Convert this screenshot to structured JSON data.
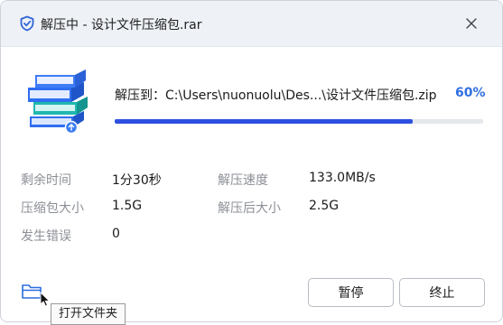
{
  "window": {
    "title": "解压中 - 设计文件压缩包.rar"
  },
  "extract": {
    "path_label": "解压到：C:\\Users\\nuonuolu\\Des...\\设计文件压缩包.zip",
    "percent_text": "60%",
    "progress": 0.81
  },
  "stats": {
    "remaining_time_label": "剩余时间",
    "remaining_time_value": "1分30秒",
    "speed_label": "解压速度",
    "speed_value": "133.0MB/s",
    "archive_size_label": "压缩包大小",
    "archive_size_value": "1.5G",
    "extracted_size_label": "解压后大小",
    "extracted_size_value": "2.5G",
    "errors_label": "发生错误",
    "errors_value": "0"
  },
  "footer": {
    "tooltip": "打开文件夹",
    "pause_label": "暂停",
    "stop_label": "终止"
  },
  "colors": {
    "accent": "#2f6fe0",
    "progress": "#2d4fe0",
    "titlebar": "#eef1f6",
    "book_blue": "#2f6ef0",
    "book_teal": "#1fb8b0"
  },
  "icons": {
    "app": "shield-check-icon",
    "close": "close-icon",
    "books": "book-stack-illustration",
    "folder": "folder-icon",
    "cursor": "mouse-pointer-icon"
  }
}
